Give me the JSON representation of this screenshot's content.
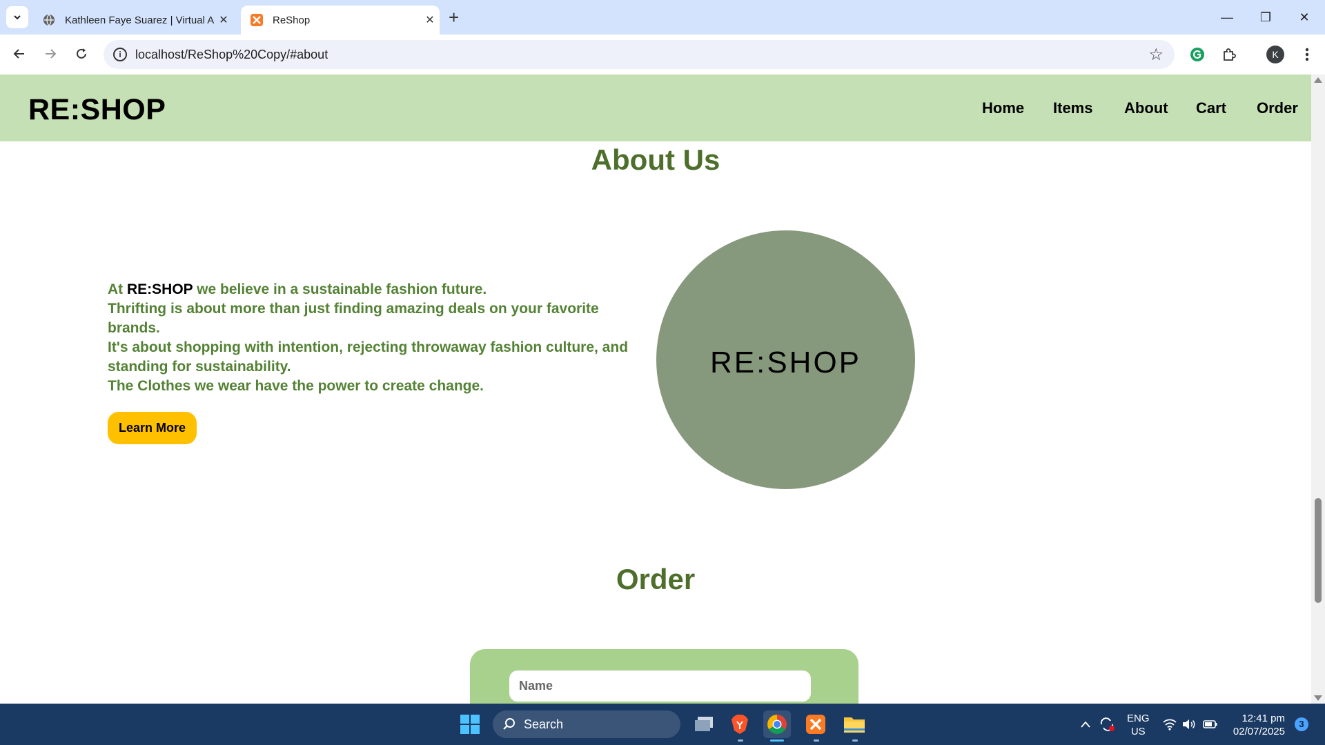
{
  "browser": {
    "tabs": [
      {
        "title": "Kathleen Faye Suarez | Virtual A",
        "active": false
      },
      {
        "title": "ReShop",
        "active": true
      }
    ],
    "url": "localhost/ReShop%20Copy/#about",
    "profile_initial": "K"
  },
  "site": {
    "logo": "RE:SHOP",
    "nav": [
      "Home",
      "Items",
      "About",
      "Cart",
      "Order"
    ]
  },
  "about": {
    "title": "About Us",
    "line1_prefix": "At ",
    "line1_brand": "RE:SHOP",
    "line1_suffix": " we believe in a sustainable fashion future.",
    "line2": "Thrifting is about more than just finding amazing deals on your favorite brands.",
    "line3": "It's about shopping with intention, rejecting throwaway fashion culture, and standing for sustainability.",
    "line4": "The Clothes we wear have the power to create change.",
    "button": "Learn More",
    "circle_logo": "RE:SHOP"
  },
  "order": {
    "title": "Order",
    "name_placeholder": "Name"
  },
  "taskbar": {
    "search_label": "Search",
    "lang_line1": "ENG",
    "lang_line2": "US",
    "time": "12:41 pm",
    "date": "02/07/2025",
    "notification_count": "3"
  },
  "colors": {
    "header_bg": "#c5e0b4",
    "heading_green": "#4e6e2b",
    "text_green": "#548235",
    "button_yellow": "#ffc000",
    "circle_bg": "#87997c",
    "form_bg": "#a9d18e"
  }
}
